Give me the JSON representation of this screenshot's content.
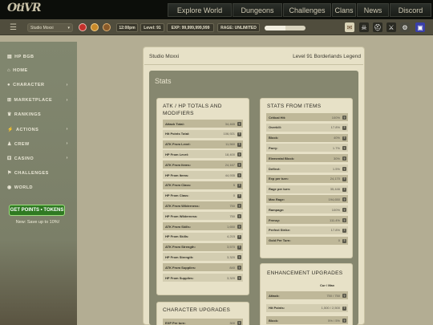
{
  "topbar": {
    "logo": "OtiVR",
    "nav": [
      "Explore World",
      "Dungeons",
      "Challenges",
      "Clans",
      "News",
      "Discord"
    ]
  },
  "statusbar": {
    "name_select": "Studio Moxxi",
    "time": "12:00pm",
    "level": "Level: 91",
    "exp": "EXP: 99,999,999,999",
    "rage": "RAGE: UNLIMITED",
    "health_fraction": 0.5
  },
  "sidebar": {
    "items": [
      {
        "label": "HP BGB",
        "icon": "book-icon",
        "caret": ""
      },
      {
        "label": "HOME",
        "icon": "home-icon",
        "caret": ""
      },
      {
        "label": "CHARACTER",
        "icon": "user-icon",
        "caret": "›"
      },
      {
        "label": "MARKETPLACE",
        "icon": "cart-icon",
        "caret": "›"
      },
      {
        "label": "RANKINGS",
        "icon": "trophy-icon",
        "caret": ""
      },
      {
        "label": "ACTIONS",
        "icon": "bolt-icon",
        "caret": "›"
      },
      {
        "label": "CREW",
        "icon": "users-icon",
        "caret": "›"
      },
      {
        "label": "CASINO",
        "icon": "dice-icon",
        "caret": "›"
      },
      {
        "label": "CHALLENGES",
        "icon": "flag-icon",
        "caret": ""
      },
      {
        "label": "WORLD",
        "icon": "globe-icon",
        "caret": ""
      }
    ],
    "points_button": "GET POINTS • TOKENS",
    "points_note": "New: Save up to 10%!"
  },
  "content": {
    "title": "Studio Moxxi",
    "level_text": "Level 91 Borderlands Legend",
    "stats_heading": "Stats"
  },
  "atk_card": {
    "title": "ATK / HP TOTALS AND MODIFIERS",
    "rows": [
      {
        "label": "Attack Total:",
        "value": "34,465"
      },
      {
        "label": "Hit Points Total:",
        "value": "106,921"
      },
      {
        "label": "ATK From Level:",
        "value": "11,560"
      },
      {
        "label": "HP From Level:",
        "value": "18,400"
      },
      {
        "label": "ATK From Items:",
        "value": "24,167"
      },
      {
        "label": "HP From Items:",
        "value": "44,935"
      },
      {
        "label": "ATK From Class:",
        "value": "5"
      },
      {
        "label": "HP From Class:",
        "value": "0"
      },
      {
        "label": "ATK From Wilderness:",
        "value": "750"
      },
      {
        "label": "HP From Wilderness:",
        "value": "750"
      },
      {
        "label": "ATK From Skills:",
        "value": "1,650"
      },
      {
        "label": "HP From Skills:",
        "value": "4,215"
      },
      {
        "label": "ATK From Strength:",
        "value": "3,570"
      },
      {
        "label": "HP From Strength:",
        "value": "3,320"
      },
      {
        "label": "ATK From Supplies:",
        "value": "840"
      },
      {
        "label": "HP From Supplies:",
        "value": "3,320"
      }
    ]
  },
  "items_card": {
    "title": "STATS FROM ITEMS",
    "rows": [
      {
        "label": "Critical Hit:",
        "value": "100%"
      },
      {
        "label": "Overkill:",
        "value": "17.8%"
      },
      {
        "label": "Block:",
        "value": "40%"
      },
      {
        "label": "Parry:",
        "value": "1.7%"
      },
      {
        "label": "Elemental Block:",
        "value": "30%"
      },
      {
        "label": "Deflect:",
        "value": "1.5%"
      },
      {
        "label": "Exp per turn:",
        "value": "24,170"
      },
      {
        "label": "Rage per turn:",
        "value": "35,446"
      },
      {
        "label": "Max Rage:",
        "value": "194,650"
      },
      {
        "label": "Rampage:",
        "value": "100%"
      },
      {
        "label": "Frenzy:",
        "value": "111.4%"
      },
      {
        "label": "Perfect Strike:",
        "value": "17.8%"
      },
      {
        "label": "Gold Per Turn:",
        "value": "0"
      }
    ]
  },
  "enh_card": {
    "title": "ENHANCEMENT UPGRADES",
    "col_header": "Cur / Max",
    "rows": [
      {
        "label": "Attack:",
        "value": "750 / 750"
      },
      {
        "label": "Hit Points:",
        "value": "1,500 / 2,500"
      },
      {
        "label": "Block:",
        "value": "5% / 5%"
      }
    ]
  },
  "char_card": {
    "title": "CHARACTER UPGRADES",
    "rows": [
      {
        "label": "EXP Per turn:",
        "value": "300"
      }
    ]
  }
}
